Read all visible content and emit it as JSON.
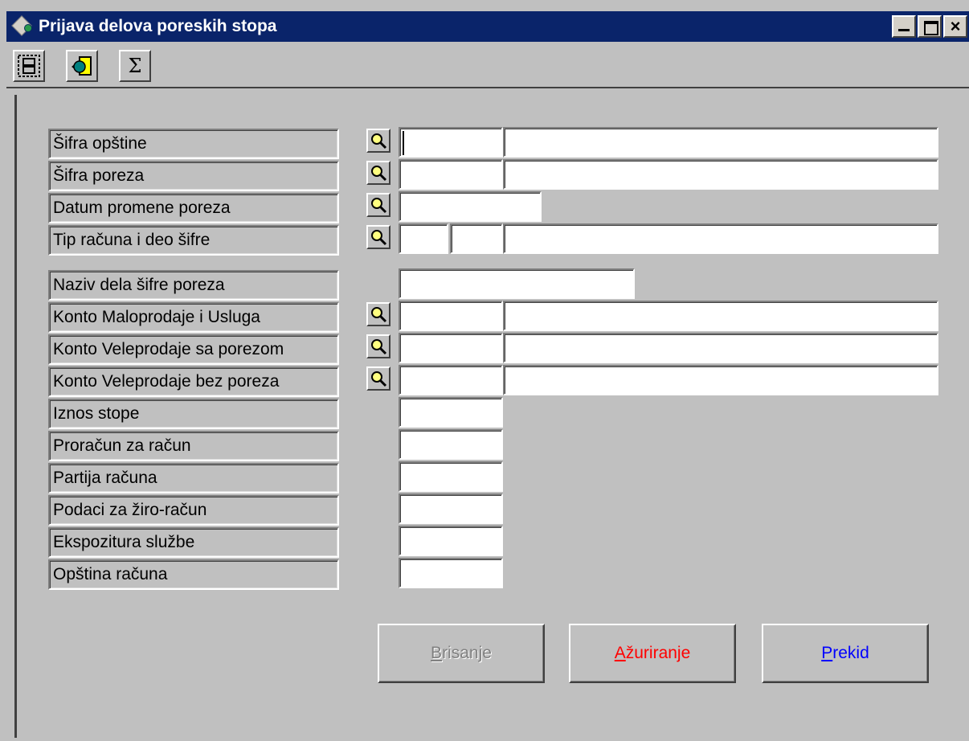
{
  "window": {
    "title": "Prijava delova poreskih stopa"
  },
  "toolbar": {
    "tools": [
      "layout-icon",
      "tag-icon",
      "sigma-icon"
    ],
    "sigma_glyph": "Σ"
  },
  "form": {
    "labels": [
      "Šifra opštine",
      "Šifra poreza",
      "Datum promene poreza",
      "Tip računa i deo šifre",
      "Naziv dela šifre poreza",
      "Konto Maloprodaje i Usluga",
      "Konto Veleprodaje sa porezom",
      "Konto Veleprodaje bez poreza",
      "Iznos stope",
      "Proračun za račun",
      "Partija računa",
      "Podaci za žiro-račun",
      "Ekspozitura službe",
      "Opština računa"
    ]
  },
  "buttons": {
    "delete": {
      "first": "B",
      "rest": "risanje"
    },
    "update": {
      "first": "A",
      "rest": "žuriranje"
    },
    "cancel": {
      "first": "P",
      "rest": "rekid"
    }
  },
  "colors": {
    "title_bar": "#0a246a",
    "window_bg": "#c0c0c0",
    "update_text": "#ff0000",
    "cancel_text": "#0000ff",
    "disabled_text": "#808080"
  }
}
